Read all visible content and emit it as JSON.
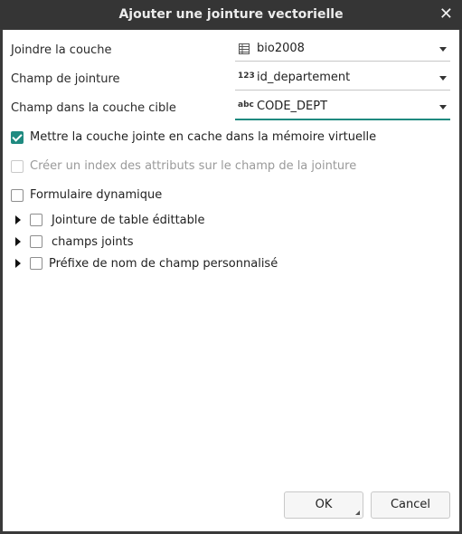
{
  "dialog": {
    "title": "Ajouter une jointure vectorielle",
    "close_icon": "close-icon"
  },
  "fields": {
    "join_layer": {
      "label": "Joindre la couche",
      "value": "bio2008",
      "icon": "layer-table-icon"
    },
    "join_field": {
      "label": "Champ de jointure",
      "value": "id_departement",
      "icon_text": "123"
    },
    "target_field": {
      "label": "Champ dans la couche cible",
      "value": "CODE_DEPT",
      "icon_text": "abc"
    }
  },
  "options": {
    "cache": {
      "label": "Mettre la couche jointe en cache dans la mémoire virtuelle",
      "checked": true
    },
    "index": {
      "label": "Créer un index des attributs sur le champ de la jointure",
      "checked": false,
      "disabled": true
    },
    "dynamic_form": {
      "label": "Formulaire dynamique",
      "checked": false
    }
  },
  "groups": [
    {
      "label": "Jointure de table édittable"
    },
    {
      "label": "champs joints"
    },
    {
      "label": "Préfixe de nom de champ personnalisé"
    }
  ],
  "buttons": {
    "ok": "OK",
    "cancel": "Cancel"
  },
  "colors": {
    "accent": "#1f8a80",
    "titlebar": "#353535"
  }
}
